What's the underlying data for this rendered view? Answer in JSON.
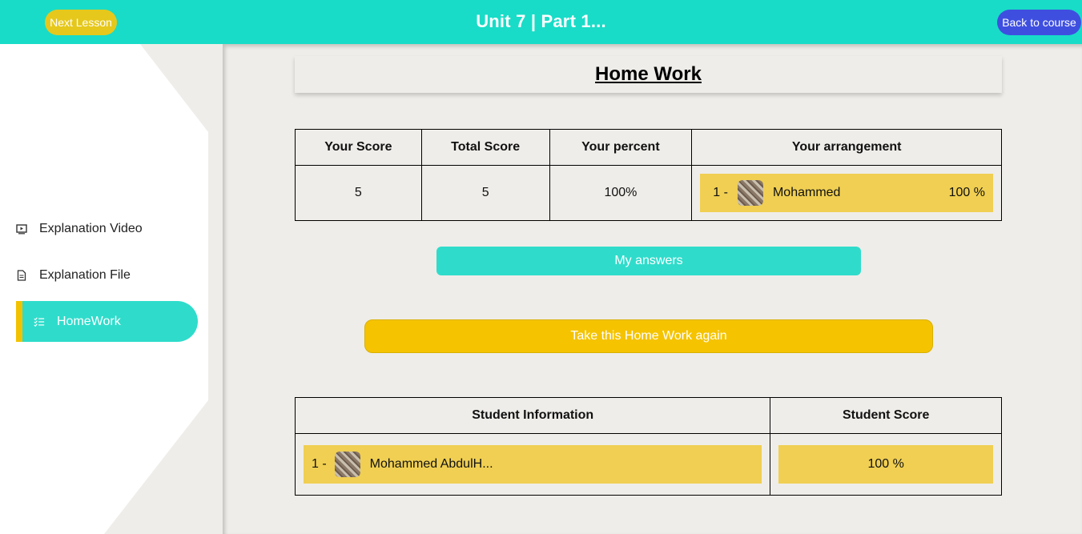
{
  "topbar": {
    "next_label": "Next Lesson",
    "title": "Unit 7 | Part 1...",
    "back_label": "Back to course",
    "color": "#18dcc7"
  },
  "sidebar": {
    "items": [
      {
        "label": "Explanation Video",
        "icon": "video-icon"
      },
      {
        "label": "Explanation File",
        "icon": "file-icon"
      },
      {
        "label": "HomeWork",
        "icon": "checklist-icon",
        "active": true
      }
    ]
  },
  "main": {
    "heading": "Home Work",
    "score_table": {
      "headers": [
        "Your Score",
        "Total Score",
        "Your percent",
        "Your arrangement"
      ],
      "row": {
        "score": "5",
        "total": "5",
        "percent": "100%",
        "rank": "1 -",
        "name": "Mohammed",
        "rank_percent": "100 %"
      }
    },
    "answers_label": "My answers",
    "retake_label": "Take this Home Work again",
    "student_table": {
      "headers": [
        "Student Information",
        "Student Score"
      ],
      "rows": [
        {
          "rank": "1 -",
          "name": "Mohammed AbdulH...",
          "score": "100 %"
        }
      ]
    }
  }
}
